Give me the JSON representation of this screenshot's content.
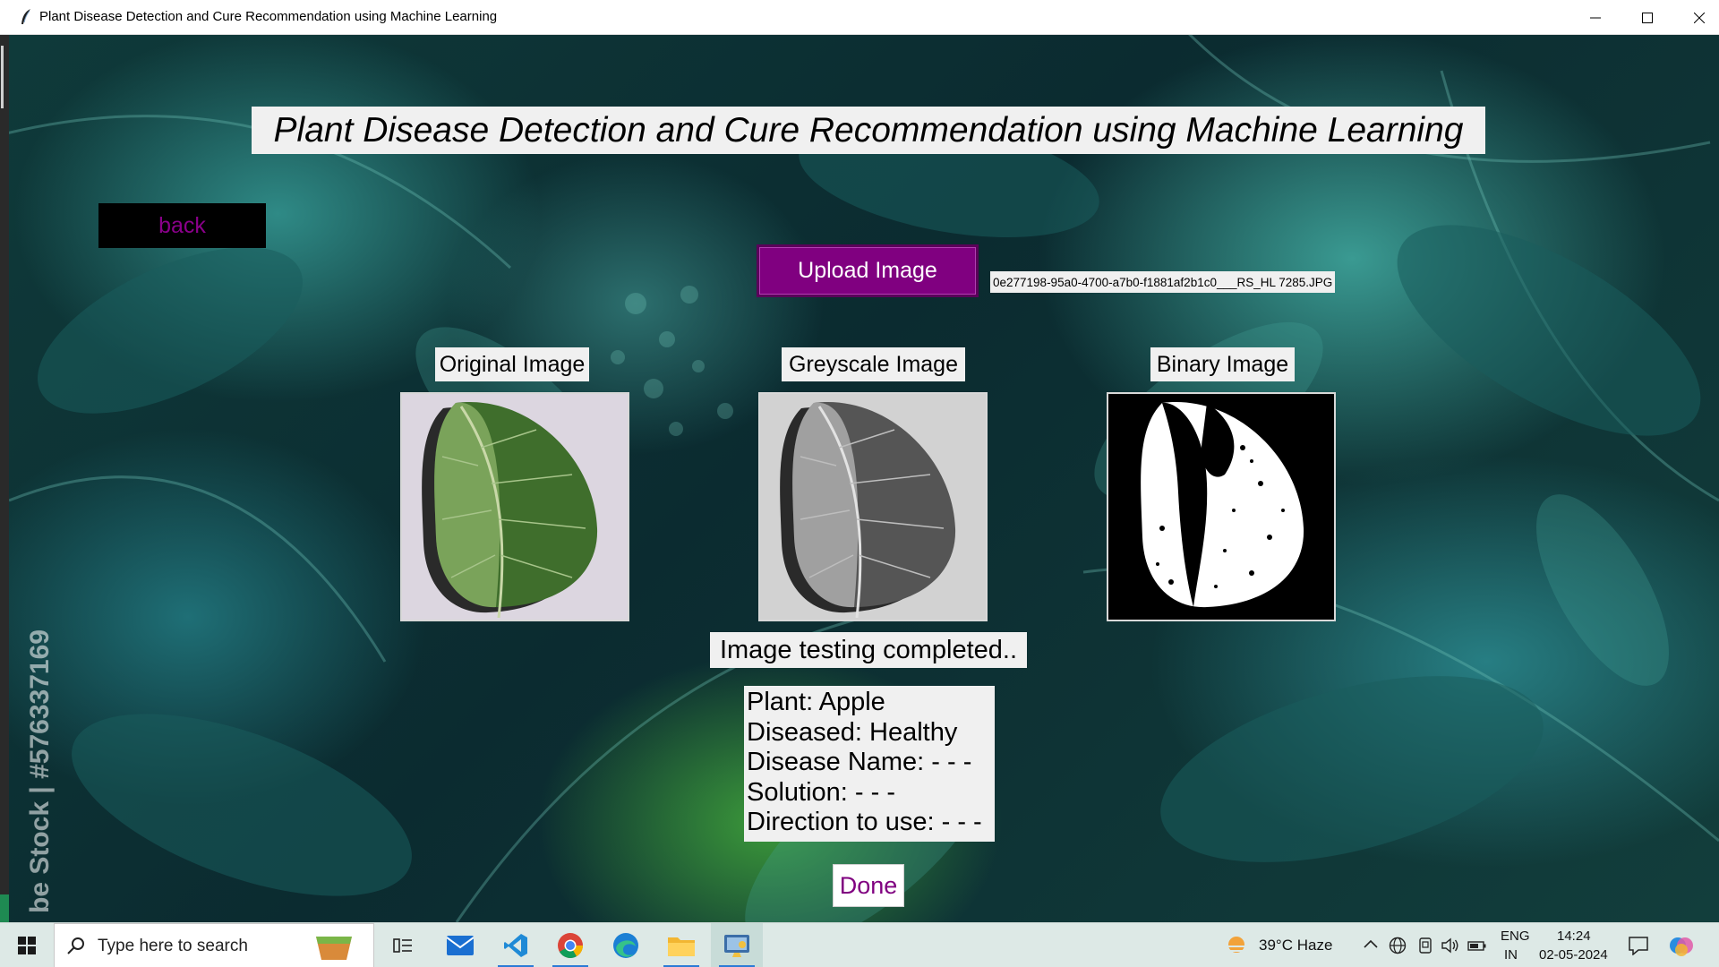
{
  "window": {
    "title": "Plant Disease Detection and Cure Recommendation using Machine Learning",
    "icons": [
      "feather-icon",
      "minimize-icon",
      "maximize-icon",
      "close-icon"
    ]
  },
  "app": {
    "heading": "Plant Disease Detection and Cure Recommendation using Machine Learning",
    "back_label": "back",
    "upload_label": "Upload Image",
    "file_name": "0e277198-95a0-4700-a7b0-f1881af2b1c0___RS_HL 7285.JPG",
    "panels": [
      {
        "label": "Original Image"
      },
      {
        "label": "Greyscale Image"
      },
      {
        "label": "Binary Image"
      }
    ],
    "status": "Image testing completed..",
    "result": {
      "plant": "Plant: Apple",
      "diseased": "Diseased: Healthy",
      "disease_name": "Disease Name: - - -",
      "solution": "Solution: - - -",
      "direction": "Direction to use: - - -"
    },
    "done_label": "Done",
    "watermark": "be Stock | #576337169",
    "colors": {
      "accent_purple": "#800080",
      "label_bg": "#f0f0f0",
      "back_bg": "#000000"
    }
  },
  "taskbar": {
    "search_placeholder": "Type here to search",
    "apps": [
      "windows-icon",
      "task-view-icon",
      "mail-icon",
      "vscode-icon",
      "chrome-icon",
      "edge-icon",
      "file-explorer-icon",
      "python-app-icon"
    ],
    "weather": "39°C  Haze",
    "language": "ENG",
    "region": "IN",
    "time": "14:24",
    "date": "02-05-2024"
  }
}
